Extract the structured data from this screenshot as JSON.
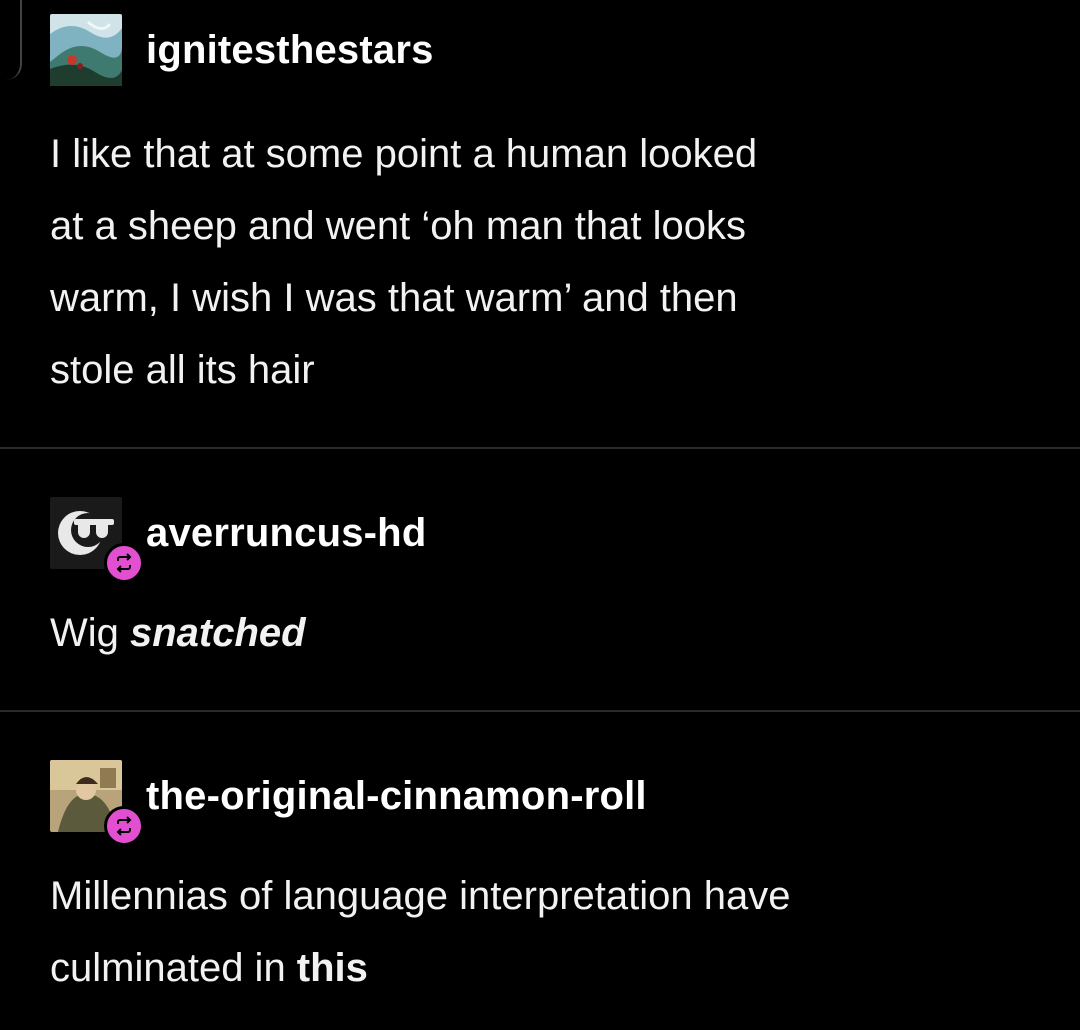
{
  "posts": [
    {
      "username": "ignitesthestars",
      "avatar_icon": "waterfall-avatar-icon",
      "reblog": false,
      "body_lines": [
        "I like that at some point a human looked",
        "at a sheep and went ‘oh man that looks",
        "warm, I wish I was that warm’ and then",
        "stole all its hair"
      ]
    },
    {
      "username": "averruncus-hd",
      "avatar_icon": "sunglasses-moon-avatar-icon",
      "reblog": true,
      "body_plain": "Wig ",
      "body_emph": "snatched"
    },
    {
      "username": "the-original-cinnamon-roll",
      "avatar_icon": "painting-avatar-icon",
      "reblog": true,
      "body_line1": "Millennias of language interpretation have",
      "body_line2_plain": "culminated in ",
      "body_line2_bold": "this"
    }
  ],
  "colors": {
    "background": "#000000",
    "text": "#ffffff",
    "reblog_badge": "#e34fd1",
    "divider": "#2a2a2a"
  },
  "icons": {
    "reblog": "reblog-icon"
  }
}
